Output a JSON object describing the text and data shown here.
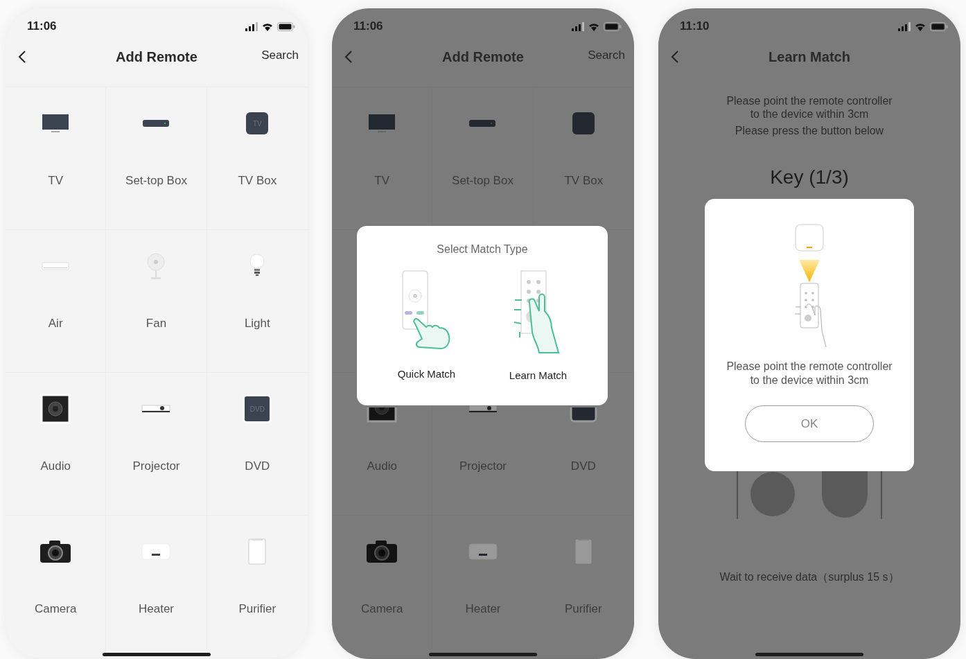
{
  "screens": [
    {
      "kind": "grid",
      "dimmed": false,
      "time": "11:06",
      "title": "Add Remote",
      "search": "Search",
      "devices": [
        {
          "kind": "tv",
          "label": "TV"
        },
        {
          "kind": "settop",
          "label": "Set-top Box"
        },
        {
          "kind": "tvbox",
          "label": "TV Box",
          "icon_text": "TV"
        },
        {
          "kind": "air",
          "label": "Air"
        },
        {
          "kind": "fan",
          "label": "Fan"
        },
        {
          "kind": "light",
          "label": "Light"
        },
        {
          "kind": "audio",
          "label": "Audio"
        },
        {
          "kind": "projector",
          "label": "Projector"
        },
        {
          "kind": "dvd",
          "label": "DVD",
          "icon_text": "DVD"
        },
        {
          "kind": "camera",
          "label": "Camera"
        },
        {
          "kind": "heater",
          "label": "Heater"
        },
        {
          "kind": "purifier",
          "label": "Purifier"
        }
      ]
    },
    {
      "kind": "grid",
      "dimmed": true,
      "time": "11:06",
      "title": "Add Remote",
      "search": "Search",
      "devices": [
        {
          "kind": "tv",
          "label": "TV"
        },
        {
          "kind": "settop",
          "label": "Set-top Box"
        },
        {
          "kind": "tvbox",
          "label": "TV Box"
        },
        {
          "kind": "audio",
          "label": "Audio"
        },
        {
          "kind": "projector",
          "label": "Projector"
        },
        {
          "kind": "dvd",
          "label": "DVD"
        },
        {
          "kind": "camera",
          "label": "Camera"
        },
        {
          "kind": "heater",
          "label": "Heater"
        },
        {
          "kind": "purifier",
          "label": "Purifier"
        }
      ],
      "dialog": {
        "title": "Select Match Type",
        "options": [
          {
            "kind": "quick",
            "label": "Quick Match"
          },
          {
            "kind": "learn",
            "label": "Learn Match"
          }
        ]
      }
    },
    {
      "kind": "learn",
      "dimmed": true,
      "time": "11:10",
      "title": "Learn Match",
      "instructions": [
        "Please point the remote controller to the device within 3cm",
        "Please press the button below"
      ],
      "key": "Key (1/3)",
      "wait": "Wait to receive data（surplus 15 s）",
      "dialog": {
        "message": "Please point the remote controller to the device within 3cm",
        "button": "OK"
      }
    }
  ]
}
